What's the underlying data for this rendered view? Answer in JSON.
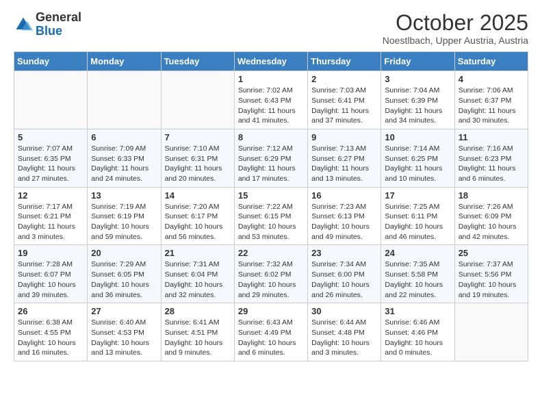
{
  "logo": {
    "line1": "General",
    "line2": "Blue"
  },
  "header": {
    "month": "October 2025",
    "location": "Noestlbach, Upper Austria, Austria"
  },
  "days_of_week": [
    "Sunday",
    "Monday",
    "Tuesday",
    "Wednesday",
    "Thursday",
    "Friday",
    "Saturday"
  ],
  "weeks": [
    [
      {
        "day": "",
        "info": ""
      },
      {
        "day": "",
        "info": ""
      },
      {
        "day": "",
        "info": ""
      },
      {
        "day": "1",
        "info": "Sunrise: 7:02 AM\nSunset: 6:43 PM\nDaylight: 11 hours\nand 41 minutes."
      },
      {
        "day": "2",
        "info": "Sunrise: 7:03 AM\nSunset: 6:41 PM\nDaylight: 11 hours\nand 37 minutes."
      },
      {
        "day": "3",
        "info": "Sunrise: 7:04 AM\nSunset: 6:39 PM\nDaylight: 11 hours\nand 34 minutes."
      },
      {
        "day": "4",
        "info": "Sunrise: 7:06 AM\nSunset: 6:37 PM\nDaylight: 11 hours\nand 30 minutes."
      }
    ],
    [
      {
        "day": "5",
        "info": "Sunrise: 7:07 AM\nSunset: 6:35 PM\nDaylight: 11 hours\nand 27 minutes."
      },
      {
        "day": "6",
        "info": "Sunrise: 7:09 AM\nSunset: 6:33 PM\nDaylight: 11 hours\nand 24 minutes."
      },
      {
        "day": "7",
        "info": "Sunrise: 7:10 AM\nSunset: 6:31 PM\nDaylight: 11 hours\nand 20 minutes."
      },
      {
        "day": "8",
        "info": "Sunrise: 7:12 AM\nSunset: 6:29 PM\nDaylight: 11 hours\nand 17 minutes."
      },
      {
        "day": "9",
        "info": "Sunrise: 7:13 AM\nSunset: 6:27 PM\nDaylight: 11 hours\nand 13 minutes."
      },
      {
        "day": "10",
        "info": "Sunrise: 7:14 AM\nSunset: 6:25 PM\nDaylight: 11 hours\nand 10 minutes."
      },
      {
        "day": "11",
        "info": "Sunrise: 7:16 AM\nSunset: 6:23 PM\nDaylight: 11 hours\nand 6 minutes."
      }
    ],
    [
      {
        "day": "12",
        "info": "Sunrise: 7:17 AM\nSunset: 6:21 PM\nDaylight: 11 hours\nand 3 minutes."
      },
      {
        "day": "13",
        "info": "Sunrise: 7:19 AM\nSunset: 6:19 PM\nDaylight: 10 hours\nand 59 minutes."
      },
      {
        "day": "14",
        "info": "Sunrise: 7:20 AM\nSunset: 6:17 PM\nDaylight: 10 hours\nand 56 minutes."
      },
      {
        "day": "15",
        "info": "Sunrise: 7:22 AM\nSunset: 6:15 PM\nDaylight: 10 hours\nand 53 minutes."
      },
      {
        "day": "16",
        "info": "Sunrise: 7:23 AM\nSunset: 6:13 PM\nDaylight: 10 hours\nand 49 minutes."
      },
      {
        "day": "17",
        "info": "Sunrise: 7:25 AM\nSunset: 6:11 PM\nDaylight: 10 hours\nand 46 minutes."
      },
      {
        "day": "18",
        "info": "Sunrise: 7:26 AM\nSunset: 6:09 PM\nDaylight: 10 hours\nand 42 minutes."
      }
    ],
    [
      {
        "day": "19",
        "info": "Sunrise: 7:28 AM\nSunset: 6:07 PM\nDaylight: 10 hours\nand 39 minutes."
      },
      {
        "day": "20",
        "info": "Sunrise: 7:29 AM\nSunset: 6:05 PM\nDaylight: 10 hours\nand 36 minutes."
      },
      {
        "day": "21",
        "info": "Sunrise: 7:31 AM\nSunset: 6:04 PM\nDaylight: 10 hours\nand 32 minutes."
      },
      {
        "day": "22",
        "info": "Sunrise: 7:32 AM\nSunset: 6:02 PM\nDaylight: 10 hours\nand 29 minutes."
      },
      {
        "day": "23",
        "info": "Sunrise: 7:34 AM\nSunset: 6:00 PM\nDaylight: 10 hours\nand 26 minutes."
      },
      {
        "day": "24",
        "info": "Sunrise: 7:35 AM\nSunset: 5:58 PM\nDaylight: 10 hours\nand 22 minutes."
      },
      {
        "day": "25",
        "info": "Sunrise: 7:37 AM\nSunset: 5:56 PM\nDaylight: 10 hours\nand 19 minutes."
      }
    ],
    [
      {
        "day": "26",
        "info": "Sunrise: 6:38 AM\nSunset: 4:55 PM\nDaylight: 10 hours\nand 16 minutes."
      },
      {
        "day": "27",
        "info": "Sunrise: 6:40 AM\nSunset: 4:53 PM\nDaylight: 10 hours\nand 13 minutes."
      },
      {
        "day": "28",
        "info": "Sunrise: 6:41 AM\nSunset: 4:51 PM\nDaylight: 10 hours\nand 9 minutes."
      },
      {
        "day": "29",
        "info": "Sunrise: 6:43 AM\nSunset: 4:49 PM\nDaylight: 10 hours\nand 6 minutes."
      },
      {
        "day": "30",
        "info": "Sunrise: 6:44 AM\nSunset: 4:48 PM\nDaylight: 10 hours\nand 3 minutes."
      },
      {
        "day": "31",
        "info": "Sunrise: 6:46 AM\nSunset: 4:46 PM\nDaylight: 10 hours\nand 0 minutes."
      },
      {
        "day": "",
        "info": ""
      }
    ]
  ]
}
